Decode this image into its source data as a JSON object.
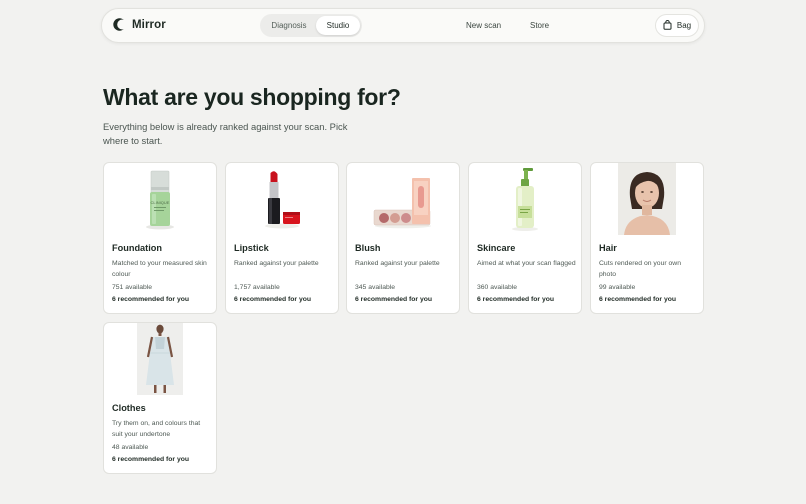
{
  "nav": {
    "brand": "Mirror",
    "tabs": [
      "Diagnosis",
      "Studio"
    ],
    "active_tab": "Studio",
    "links": [
      "New scan",
      "Store"
    ],
    "bag": "Bag"
  },
  "hero": {
    "title": "What are you shopping for?",
    "subtitle": "Everything below is already ranked against your scan. Pick where to start."
  },
  "categories": [
    {
      "title": "Foundation",
      "desc": "Matched to your measured skin colour",
      "available": "751 available",
      "recommended": "6 recommended for you",
      "image": "foundation-bottle"
    },
    {
      "title": "Lipstick",
      "desc": "Ranked against your palette",
      "available": "1,757 available",
      "recommended": "6 recommended for you",
      "image": "lipstick-tube"
    },
    {
      "title": "Blush",
      "desc": "Ranked against your palette",
      "available": "345 available",
      "recommended": "6 recommended for you",
      "image": "blush-palette"
    },
    {
      "title": "Skincare",
      "desc": "Aimed at what your scan flagged",
      "available": "360 available",
      "recommended": "6 recommended for you",
      "image": "pump-bottle"
    },
    {
      "title": "Hair",
      "desc": "Cuts rendered on your own photo",
      "available": "99 available",
      "recommended": "6 recommended for you",
      "image": "woman-portrait"
    },
    {
      "title": "Clothes",
      "desc": "Try them on, and colours that suit your undertone",
      "available": "48 available",
      "recommended": "6 recommended for you",
      "image": "dress-model"
    }
  ],
  "colors": {
    "accent": "#1f2a24",
    "background": "#f2f2f0",
    "card": "#ffffff"
  }
}
